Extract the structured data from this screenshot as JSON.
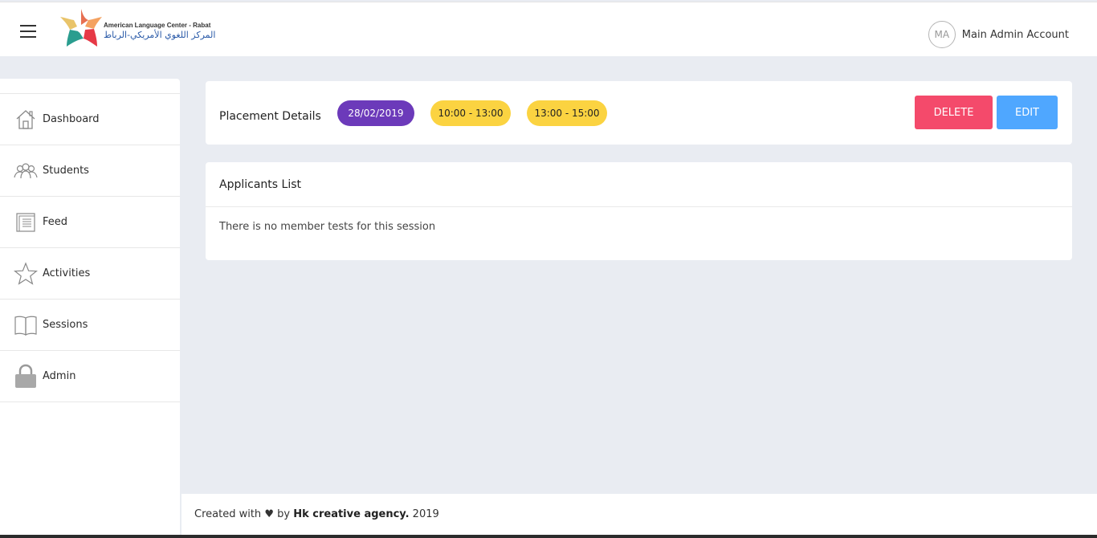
{
  "header": {
    "logo_en": "American Language Center - Rabat",
    "logo_ar": "المركز اللغوي الأمريكي-الرباط",
    "account": {
      "initials": "MA",
      "name": "Main Admin Account"
    }
  },
  "sidebar": {
    "items": [
      {
        "label": "Dashboard",
        "icon": "house-icon"
      },
      {
        "label": "Students",
        "icon": "users-icon"
      },
      {
        "label": "Feed",
        "icon": "newspaper-icon"
      },
      {
        "label": "Activities",
        "icon": "star-icon"
      },
      {
        "label": "Sessions",
        "icon": "book-icon"
      },
      {
        "label": "Admin",
        "icon": "lock-icon"
      }
    ]
  },
  "details": {
    "title": "Placement Details",
    "date": "28/02/2019",
    "time_slots": [
      "10:00 - 13:00",
      "13:00 - 15:00"
    ],
    "delete_label": "DELETE",
    "edit_label": "EDIT"
  },
  "applicants": {
    "title": "Applicants List",
    "empty_message": "There is no member tests for this session"
  },
  "footer": {
    "prefix": "Created with",
    "heart": "♥",
    "by": "by",
    "agency": "Hk creative agency.",
    "year": "2019"
  },
  "colors": {
    "date_pill": "#6c3aba",
    "time_pill": "#fbd341",
    "delete": "#f44a6b",
    "edit": "#4fa7ff",
    "background": "#e9ecf2"
  }
}
